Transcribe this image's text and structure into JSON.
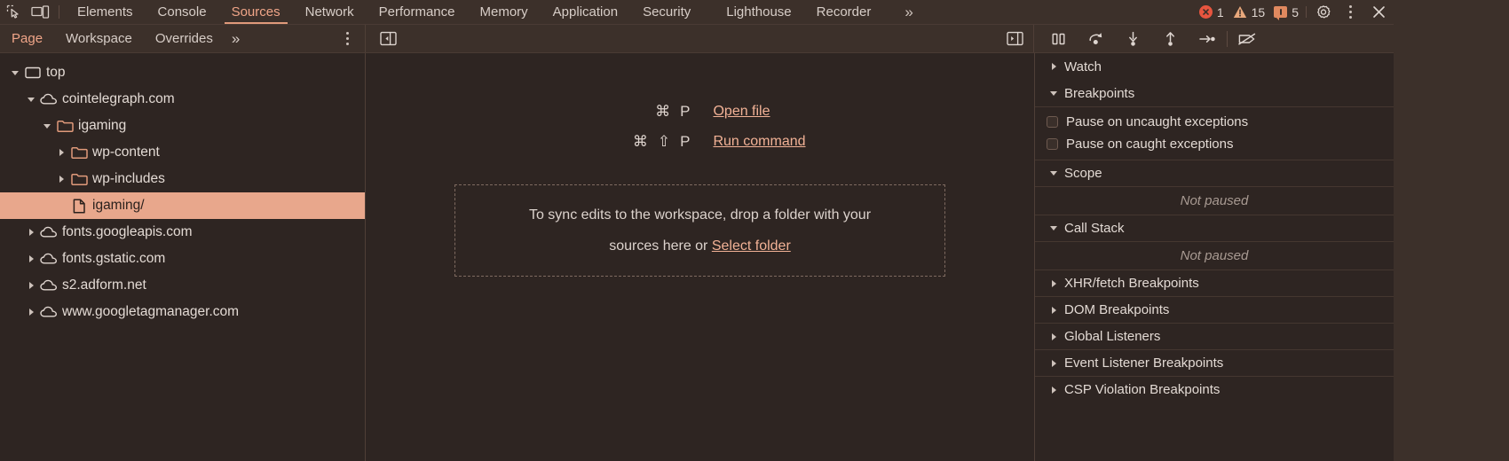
{
  "tabbar": {
    "left_icons": [
      {
        "name": "inspect-element-icon"
      },
      {
        "name": "device-toolbar-icon"
      }
    ],
    "tabs": [
      {
        "label": "Elements",
        "active": false
      },
      {
        "label": "Console",
        "active": false
      },
      {
        "label": "Sources",
        "active": true
      },
      {
        "label": "Network",
        "active": false
      },
      {
        "label": "Performance",
        "active": false
      },
      {
        "label": "Memory",
        "active": false
      },
      {
        "label": "Application",
        "active": false
      },
      {
        "label": "Security",
        "active": false
      },
      {
        "label": "Lighthouse",
        "active": false
      },
      {
        "label": "Recorder",
        "active": false
      }
    ],
    "more_tabs": "»",
    "counters": {
      "errors": "1",
      "warnings": "15",
      "infos": "5"
    },
    "settings_icon": "gear-icon",
    "menu_icon": "kebab-menu-icon",
    "close_icon": "close-icon"
  },
  "subbar": {
    "tabs": [
      {
        "label": "Page",
        "active": true
      },
      {
        "label": "Workspace",
        "active": false
      },
      {
        "label": "Overrides",
        "active": false
      }
    ],
    "more": "»",
    "menu_icon": "kebab-menu-icon",
    "navigator_toggle_icon": "collapse-navigator-icon",
    "debugger_toggle_icon": "expand-debugger-icon",
    "debug_controls": [
      {
        "name": "pause-script-execution-button"
      },
      {
        "name": "step-over-next-function-call-button"
      },
      {
        "name": "step-into-next-function-call-button"
      },
      {
        "name": "step-out-of-current-function-button"
      },
      {
        "name": "step-button"
      },
      {
        "name": "deactivate-breakpoints-button"
      }
    ]
  },
  "navigator": {
    "tree": [
      {
        "label": "top",
        "icon": "frame-icon",
        "indent": 0,
        "arrow": "open",
        "selected": false
      },
      {
        "label": "cointelegraph.com",
        "icon": "cloud-icon",
        "indent": 1,
        "arrow": "open",
        "selected": false
      },
      {
        "label": "igaming",
        "icon": "folder-icon",
        "indent": 2,
        "arrow": "open",
        "selected": false
      },
      {
        "label": "wp-content",
        "icon": "folder-icon",
        "indent": 3,
        "arrow": "closed",
        "selected": false
      },
      {
        "label": "wp-includes",
        "icon": "folder-icon",
        "indent": 3,
        "arrow": "closed",
        "selected": false
      },
      {
        "label": "igaming/",
        "icon": "document-icon",
        "indent": 3,
        "arrow": "none",
        "selected": true
      },
      {
        "label": "fonts.googleapis.com",
        "icon": "cloud-icon",
        "indent": 1,
        "arrow": "closed",
        "selected": false
      },
      {
        "label": "fonts.gstatic.com",
        "icon": "cloud-icon",
        "indent": 1,
        "arrow": "closed",
        "selected": false
      },
      {
        "label": "s2.adform.net",
        "icon": "cloud-icon",
        "indent": 1,
        "arrow": "closed",
        "selected": false
      },
      {
        "label": "www.googletagmanager.com",
        "icon": "cloud-icon",
        "indent": 1,
        "arrow": "closed",
        "selected": false
      }
    ]
  },
  "editor": {
    "shortcuts": [
      {
        "keys": [
          "⌘",
          "P"
        ],
        "link": "Open file"
      },
      {
        "keys": [
          "⌘",
          "⇧",
          "P"
        ],
        "link": "Run command"
      }
    ],
    "dropzone": {
      "line1": "To sync edits to the workspace, drop a folder with your",
      "line2_prefix": "sources here or ",
      "line2_link": "Select folder"
    }
  },
  "debugger": {
    "sections": [
      {
        "title": "Watch",
        "state": "collapsed"
      },
      {
        "title": "Breakpoints",
        "state": "expanded"
      },
      {
        "title": "Scope",
        "state": "expanded"
      },
      {
        "title": "Call Stack",
        "state": "expanded"
      },
      {
        "title": "XHR/fetch Breakpoints",
        "state": "collapsed"
      },
      {
        "title": "DOM Breakpoints",
        "state": "collapsed"
      },
      {
        "title": "Global Listeners",
        "state": "collapsed"
      },
      {
        "title": "Event Listener Breakpoints",
        "state": "collapsed"
      },
      {
        "title": "CSP Violation Breakpoints",
        "state": "collapsed"
      }
    ],
    "checkboxes": [
      {
        "label": "Pause on uncaught exceptions",
        "checked": false
      },
      {
        "label": "Pause on caught exceptions",
        "checked": false
      }
    ],
    "scope_status": "Not paused",
    "callstack_status": "Not paused"
  },
  "colors": {
    "toolbar_bg": "#3c302a",
    "panel_bg": "#2e2522",
    "accent": "#f0a588",
    "selection": "#e8a78c",
    "text": "#e3dad4",
    "error": "#e8553f",
    "warning": "#e8a87c"
  }
}
